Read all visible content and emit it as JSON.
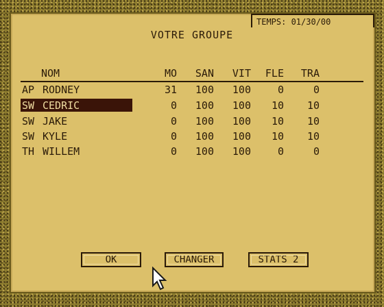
{
  "top_tab": {
    "text": "TEMPS: 01/30/00"
  },
  "title": "VOTRE GROUPE",
  "columns": [
    "NOM",
    "MO",
    "SAN",
    "VIT",
    "FLE",
    "TRA"
  ],
  "rows": [
    {
      "role": "AP",
      "name": "RODNEY",
      "mo": "31",
      "san": "100",
      "vit": "100",
      "fle": "0",
      "tra": "0"
    },
    {
      "role": "SW",
      "name": "CEDRIC",
      "mo": "0",
      "san": "100",
      "vit": "100",
      "fle": "10",
      "tra": "10",
      "selected": true
    },
    {
      "role": "SW",
      "name": "JAKE",
      "mo": "0",
      "san": "100",
      "vit": "100",
      "fle": "10",
      "tra": "10"
    },
    {
      "role": "SW",
      "name": "KYLE",
      "mo": "0",
      "san": "100",
      "vit": "100",
      "fle": "10",
      "tra": "10"
    },
    {
      "role": "TH",
      "name": "WILLEM",
      "mo": "0",
      "san": "100",
      "vit": "100",
      "fle": "0",
      "tra": "0"
    }
  ],
  "buttons": {
    "ok": "OK",
    "changer": "CHANGER",
    "stats": "STATS 2"
  },
  "colors": {
    "panel": "#dcc06a",
    "highlight": "#3a1408",
    "border": "#8a7a2e"
  },
  "icons": {
    "pointer": "mouse-pointer-icon"
  }
}
